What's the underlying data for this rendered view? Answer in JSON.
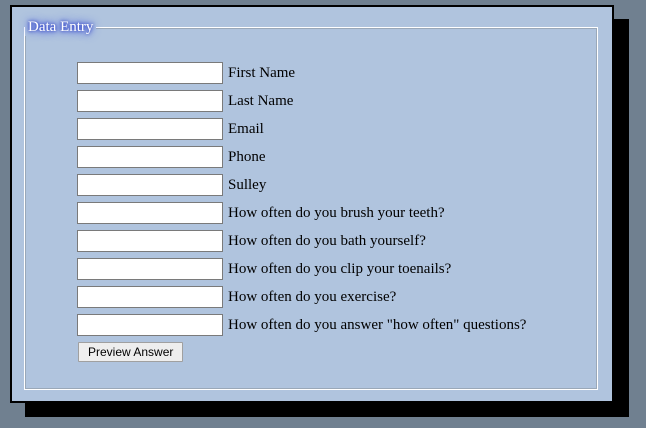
{
  "form": {
    "legend": "Data Entry",
    "fields": [
      {
        "label": "First Name",
        "value": ""
      },
      {
        "label": "Last Name",
        "value": ""
      },
      {
        "label": "Email",
        "value": ""
      },
      {
        "label": "Phone",
        "value": ""
      },
      {
        "label": "Sulley",
        "value": ""
      },
      {
        "label": "How often do you brush your teeth?",
        "value": ""
      },
      {
        "label": "How often do you bath yourself?",
        "value": ""
      },
      {
        "label": "How often do you clip your toenails?",
        "value": ""
      },
      {
        "label": "How often do you exercise?",
        "value": ""
      },
      {
        "label": "How often do you answer \"how often\" questions?",
        "value": ""
      }
    ],
    "preview_button_label": "Preview Answer"
  },
  "colors": {
    "page_background": "#708090",
    "panel_background": "#b0c4de",
    "shadow": "#000000",
    "legend_glow": "#2b3fd6"
  }
}
